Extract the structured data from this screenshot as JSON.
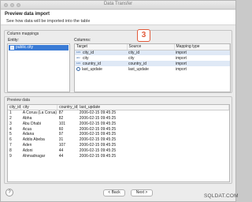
{
  "window": {
    "title": "Data Transfer"
  },
  "header": {
    "title": "Preview data import",
    "subtitle": "See how data will be imported into the table"
  },
  "mappings": {
    "section_title": "Column mappings",
    "entity_label": "Entity:",
    "entity_value": "public.city",
    "columns_label": "Columns:",
    "headers": [
      "Target",
      "Source",
      "Mapping type"
    ],
    "rows": [
      {
        "target": "city_id",
        "source": "city_id",
        "type": "import",
        "icon": "numeric-column-icon"
      },
      {
        "target": "city",
        "source": "city",
        "type": "import",
        "icon": "text-column-icon"
      },
      {
        "target": "country_id",
        "source": "country_id",
        "type": "import",
        "icon": "numeric-column-icon"
      },
      {
        "target": "last_update",
        "source": "last_update",
        "type": "import",
        "icon": "clock-column-icon"
      }
    ]
  },
  "callout": {
    "number": "3",
    "color": "#e25a3a"
  },
  "preview": {
    "section_title": "Preview data",
    "headers": [
      "city_id",
      "city",
      "country_id",
      "last_update"
    ],
    "rows": [
      [
        "1",
        "A Corua (La Corua)",
        "87",
        "2006-02-15 09:45:25"
      ],
      [
        "2",
        "Abha",
        "82",
        "2006-02-15 09:45:25"
      ],
      [
        "3",
        "Abu Dhabi",
        "101",
        "2006-02-15 09:45:25"
      ],
      [
        "4",
        "Acua",
        "60",
        "2006-02-15 09:45:25"
      ],
      [
        "5",
        "Adana",
        "97",
        "2006-02-15 09:45:25"
      ],
      [
        "6",
        "Addis Abeba",
        "31",
        "2006-02-15 09:45:25"
      ],
      [
        "7",
        "Aden",
        "107",
        "2006-02-15 09:45:25"
      ],
      [
        "8",
        "Adoni",
        "44",
        "2006-02-15 09:45:25"
      ],
      [
        "9",
        "Ahmadnagar",
        "44",
        "2006-02-15 09:45:25"
      ]
    ]
  },
  "footer": {
    "help": "?",
    "back": "< Back",
    "next": "Next >",
    "watermark": "SQLDAT.COM"
  },
  "colors": {
    "selection": "#3a7bd5",
    "accent": "#e25a3a"
  }
}
